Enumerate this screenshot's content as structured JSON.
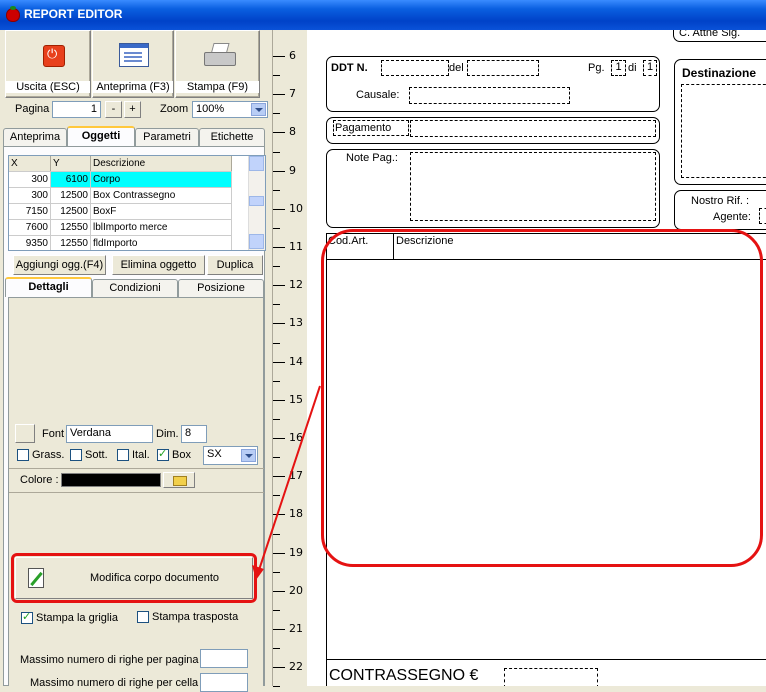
{
  "window": {
    "title": "REPORT EDITOR"
  },
  "toolbar": {
    "exit_label": "Uscita (ESC)",
    "preview_label": "Anteprima (F3)",
    "print_label": "Stampa (F9)"
  },
  "nav": {
    "page_label": "Pagina",
    "page_value": "1",
    "minus": "-",
    "plus": "+",
    "zoom_label": "Zoom",
    "zoom_value": "100%"
  },
  "tabs": [
    "Anteprima",
    "Oggetti",
    "Parametri",
    "Etichette"
  ],
  "objects_table": {
    "headers": [
      "X",
      "Y",
      "Descrizione"
    ],
    "rows": [
      [
        "300",
        "6100",
        "Corpo"
      ],
      [
        "300",
        "12500",
        "Box Contrassegno"
      ],
      [
        "7150",
        "12500",
        "BoxF"
      ],
      [
        "7600",
        "12550",
        "lblImporto merce"
      ],
      [
        "9350",
        "12550",
        "fldImporto"
      ]
    ]
  },
  "object_buttons": {
    "add": "Aggiungi ogg.(F4)",
    "delete": "Elimina oggetto",
    "duplicate": "Duplica"
  },
  "subtabs": [
    "Dettagli",
    "Condizioni",
    "Posizione"
  ],
  "font": {
    "label": "Font",
    "value": "Verdana",
    "dim_label": "Dim.",
    "dim_value": "8"
  },
  "style": {
    "bold": "Grass.",
    "underline": "Sott.",
    "italic": "Ital.",
    "box": "Box",
    "align": "SX"
  },
  "color": {
    "label": "Colore :",
    "swatch": "#000000"
  },
  "body_button": "Modifica corpo documento",
  "options": {
    "print_grid": "Stampa la griglia",
    "print_transposed": "Stampa trasposta",
    "max_rows_page": "Massimo numero di righe per pagina :",
    "max_rows_cell": "Massimo numero di righe per cella :"
  },
  "ruler": [
    "6",
    "7",
    "8",
    "9",
    "10",
    "11",
    "12",
    "13",
    "14",
    "15",
    "16",
    "17",
    "18",
    "19",
    "20",
    "21",
    "22"
  ],
  "document": {
    "partial_top": "C. Attne Sig.",
    "ddt": "DDT N.",
    "del": "del",
    "pg": "Pg.",
    "pg_num": "1",
    "di": "di",
    "pg_total": "1",
    "causale": "Causale:",
    "destinazione": "Destinazione",
    "pagamento": "Pagamento",
    "note_pag": "Note Pag.:",
    "nostro_rif": "Nostro Rif. :",
    "agente": "Agente:",
    "col_code": "Cod.Art.",
    "col_desc": "Descrizione",
    "contrassegno": "CONTRASSEGNO €"
  },
  "colors": {
    "highlight": "#00ffff",
    "annotation": "#e51212",
    "titlebar": "#0a5fe0"
  }
}
